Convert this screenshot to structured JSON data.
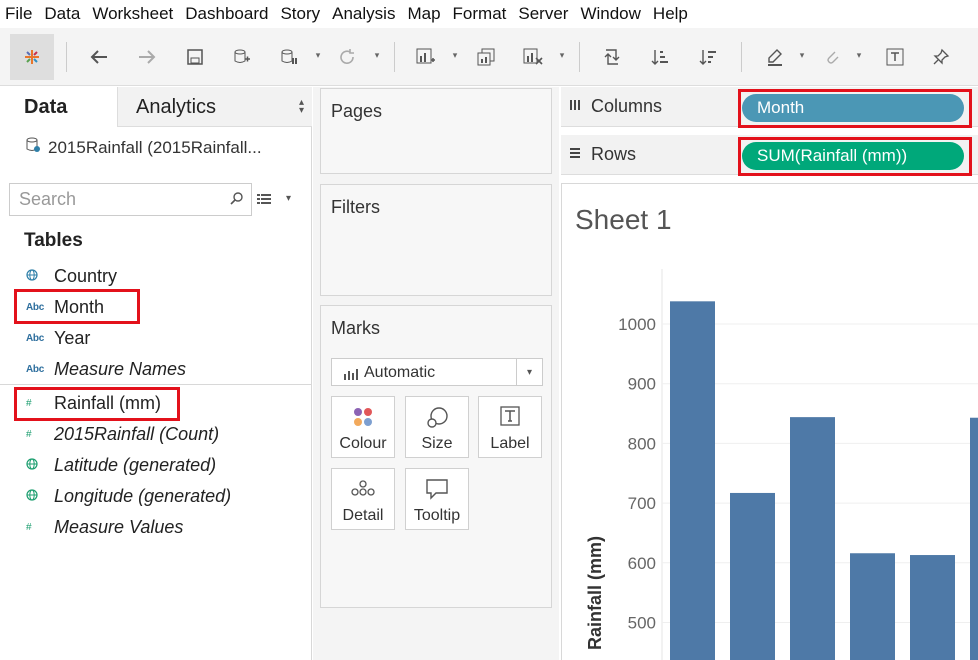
{
  "menu": [
    "File",
    "Data",
    "Worksheet",
    "Dashboard",
    "Story",
    "Analysis",
    "Map",
    "Format",
    "Server",
    "Window",
    "Help"
  ],
  "left_pane": {
    "tab_data": "Data",
    "tab_analytics": "Analytics",
    "datasource": "2015Rainfall (2015Rainfall...",
    "search_placeholder": "Search",
    "tables_heading": "Tables",
    "dimensions": [
      {
        "icon": "globe-icon",
        "name": "Country"
      },
      {
        "icon": "abc-icon",
        "name": "Month"
      },
      {
        "icon": "abc-icon",
        "name": "Year"
      },
      {
        "icon": "abc-icon",
        "name": "Measure Names"
      }
    ],
    "measures": [
      {
        "icon": "hash-icon",
        "name": "Rainfall (mm)"
      },
      {
        "icon": "hash-icon",
        "name": "2015Rainfall (Count)"
      },
      {
        "icon": "globe-icon",
        "name": "Latitude (generated)"
      },
      {
        "icon": "globe-icon",
        "name": "Longitude (generated)"
      },
      {
        "icon": "hash-icon",
        "name": "Measure Values"
      }
    ]
  },
  "cards": {
    "pages": "Pages",
    "filters": "Filters",
    "marks": "Marks",
    "mark_type": "Automatic",
    "mark_buttons": [
      "Colour",
      "Size",
      "Label",
      "Detail",
      "Tooltip"
    ]
  },
  "shelves": {
    "columns_label": "Columns",
    "rows_label": "Rows",
    "columns_pill": "Month",
    "rows_pill": "SUM(Rainfall (mm))"
  },
  "sheet": {
    "title": "Sheet 1"
  },
  "colors": {
    "bar": "#4e79a7",
    "pill_dimension": "#4b97b5",
    "pill_measure": "#00a87a",
    "highlight": "#e3111b"
  },
  "chart_data": {
    "type": "bar",
    "ylabel": "Rainfall (mm)",
    "yticks": [
      500,
      600,
      700,
      800,
      900,
      1000
    ],
    "values": [
      1038,
      717,
      844,
      616,
      613,
      843
    ],
    "grid": true
  }
}
